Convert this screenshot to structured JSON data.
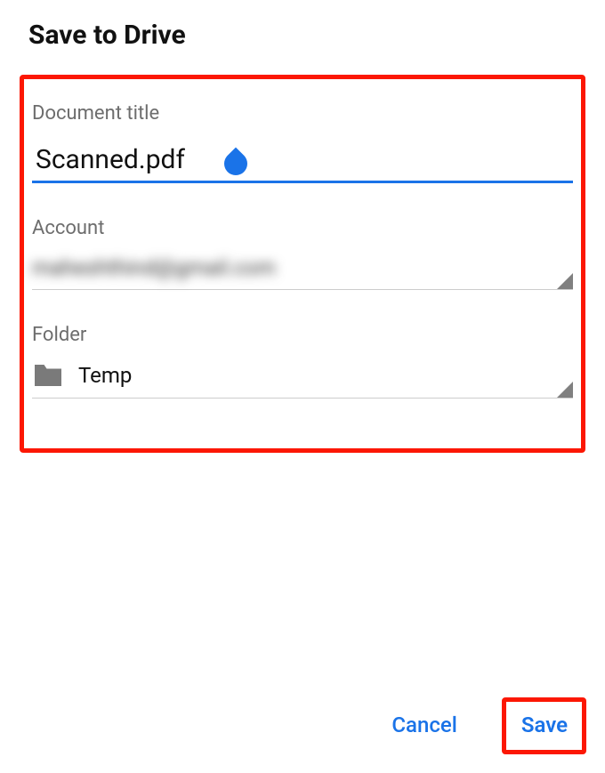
{
  "dialog": {
    "title": "Save to Drive"
  },
  "fields": {
    "documentTitle": {
      "label": "Document title",
      "value": "Scanned.pdf"
    },
    "account": {
      "label": "Account",
      "value": "maheshthind@gmail.com"
    },
    "folder": {
      "label": "Folder",
      "value": "Temp"
    }
  },
  "buttons": {
    "cancel": "Cancel",
    "save": "Save"
  },
  "colors": {
    "accent": "#1a73e8",
    "highlight": "#fc1703"
  }
}
